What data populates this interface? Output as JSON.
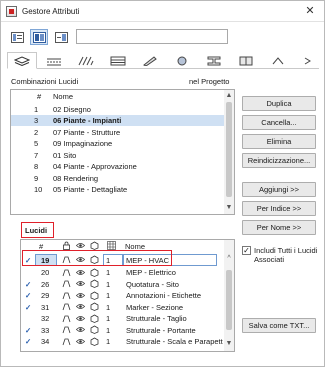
{
  "window": {
    "title": "Gestore Attributi",
    "close_glyph": "✕"
  },
  "search": {
    "value": ""
  },
  "combinations": {
    "label": "Combinazioni Lucidi",
    "in_project_label": "nel Progetto",
    "headers": {
      "num": "#",
      "name": "Nome"
    },
    "rows": [
      {
        "num": "1",
        "name": "02 Disegno",
        "selected": false
      },
      {
        "num": "3",
        "name": "06 Piante - Impianti",
        "selected": true
      },
      {
        "num": "2",
        "name": "07 Piante - Strutture",
        "selected": false
      },
      {
        "num": "5",
        "name": "09 Impaginazione",
        "selected": false
      },
      {
        "num": "7",
        "name": "01 Sito",
        "selected": false
      },
      {
        "num": "8",
        "name": "04 Piante - Approvazione",
        "selected": false
      },
      {
        "num": "9",
        "name": "08 Rendering",
        "selected": false
      },
      {
        "num": "10",
        "name": "05 Piante - Dettagliate",
        "selected": false
      }
    ]
  },
  "buttons": {
    "duplica": "Duplica",
    "cancella": "Cancella...",
    "elimina": "Elimina",
    "reindicizzazione": "Reindicizzazione...",
    "aggiungi": "Aggiungi >>",
    "per_indice": "Per Indice >>",
    "per_nome": "Per Nome >>",
    "salva_txt": "Salva come TXT..."
  },
  "include_all": {
    "label": "Includi Tutti i Lucidi Associati",
    "checked": true
  },
  "layers": {
    "label": "Lucidi",
    "headers": {
      "num": "#",
      "name": "Nome"
    },
    "rows": [
      {
        "check": "✓",
        "num": "19",
        "pen": "1",
        "name": "MEP - HVAC",
        "editing": true
      },
      {
        "check": "",
        "num": "20",
        "pen": "1",
        "name": "MEP - Elettrico",
        "editing": false
      },
      {
        "check": "✓",
        "num": "26",
        "pen": "1",
        "name": "Quotatura - Sito",
        "editing": false
      },
      {
        "check": "✓",
        "num": "29",
        "pen": "1",
        "name": "Annotazioni - Etichette",
        "editing": false
      },
      {
        "check": "✓",
        "num": "31",
        "pen": "1",
        "name": "Marker - Sezione",
        "editing": false
      },
      {
        "check": "",
        "num": "32",
        "pen": "1",
        "name": "Strutturale - Taglio",
        "editing": false
      },
      {
        "check": "✓",
        "num": "33",
        "pen": "1",
        "name": "Strutturale - Portante",
        "editing": false
      },
      {
        "check": "✓",
        "num": "34",
        "pen": "1",
        "name": "Strutturale - Scala e Parapett",
        "editing": false
      }
    ]
  },
  "colors": {
    "selection": "#cfe0f3",
    "highlight_box": "#e0202a",
    "check": "#2a5fae"
  }
}
